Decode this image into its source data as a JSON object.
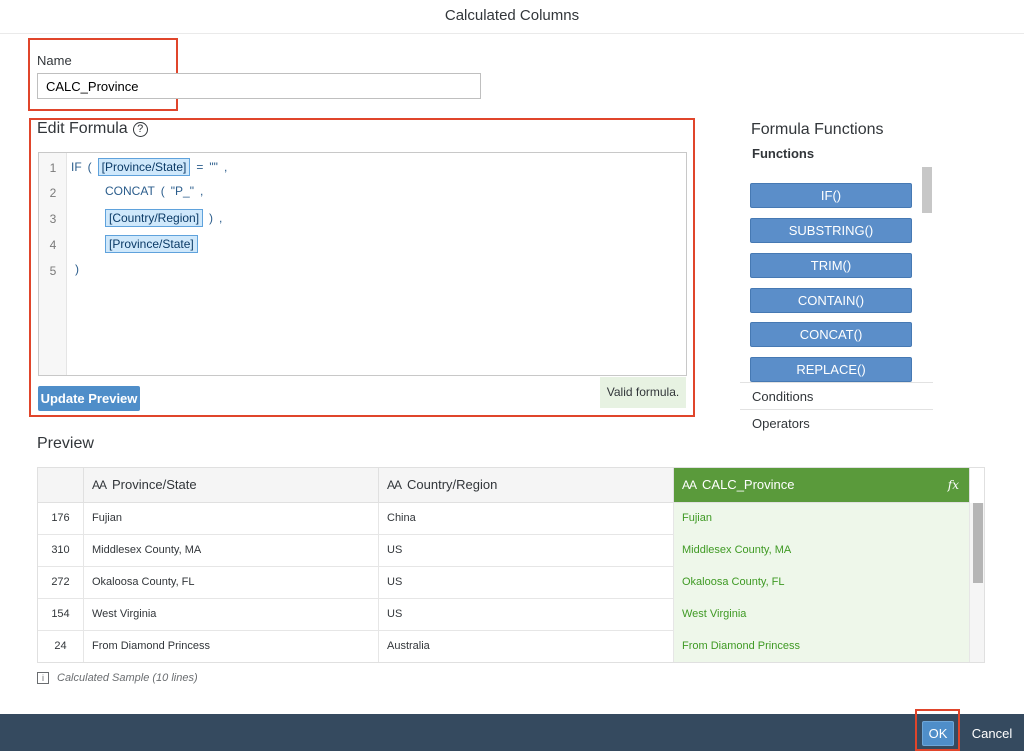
{
  "dialog": {
    "title": "Calculated Columns"
  },
  "name_section": {
    "label": "Name",
    "value": "CALC_Province"
  },
  "formula": {
    "heading": "Edit Formula",
    "help_glyph": "?",
    "line_numbers": [
      "1",
      "2",
      "3",
      "4",
      "5"
    ],
    "lines": {
      "l1_if": "IF",
      "l1_paren": "(",
      "l1_col": "[Province/State]",
      "l1_eq": "=",
      "l1_str": "\"\"",
      "l1_comma": ",",
      "l2_concat": "CONCAT",
      "l2_paren": "(",
      "l2_str": "\"P_\"",
      "l2_comma": ",",
      "l3_col": "[Country/Region]",
      "l3_paren": ")",
      "l3_comma": ",",
      "l4_col": "[Province/State]",
      "l5_paren": ")"
    },
    "update_button": "Update Preview",
    "status": "Valid formula."
  },
  "functions_panel": {
    "title": "Formula Functions",
    "subtitle": "Functions",
    "buttons": [
      "IF()",
      "SUBSTRING()",
      "TRIM()",
      "CONTAIN()",
      "CONCAT()",
      "REPLACE()"
    ],
    "sections": [
      "Conditions",
      "Operators"
    ]
  },
  "preview": {
    "heading": "Preview",
    "type_glyph": "AA",
    "fx_glyph": "fx",
    "columns": [
      "Province/State",
      "Country/Region",
      "CALC_Province"
    ],
    "rows": [
      [
        "176",
        "Fujian",
        "China",
        "Fujian"
      ],
      [
        "310",
        "Middlesex County, MA",
        "US",
        "Middlesex County, MA"
      ],
      [
        "272",
        "Okaloosa County, FL",
        "US",
        "Okaloosa County, FL"
      ],
      [
        "154",
        "West Virginia",
        "US",
        "West Virginia"
      ],
      [
        "24",
        "From Diamond Princess",
        "Australia",
        "From Diamond Princess"
      ]
    ],
    "sample_info_glyph": "i",
    "sample_note": "Calculated Sample (10 lines)"
  },
  "footer": {
    "ok": "OK",
    "cancel": "Cancel"
  },
  "colors": {
    "highlight": "#e0452b",
    "accent": "#4f8ec9",
    "calc_header": "#5a9a3b",
    "footer": "#354a5f"
  }
}
